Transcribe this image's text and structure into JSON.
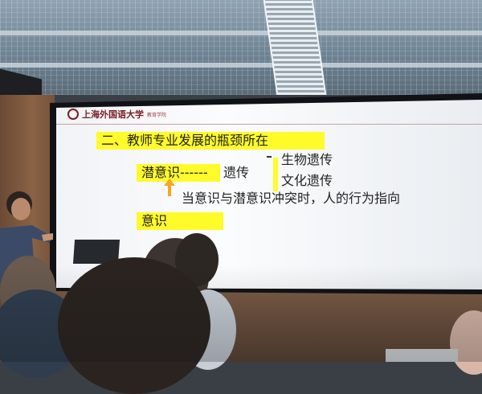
{
  "slide": {
    "logo_text": "上海外国语大学",
    "logo_subtext": "教育学院",
    "heading": "二、教师专业发展的瓶颈所在",
    "subconscious_label": "潜意识------",
    "inheritance_label": "遗传",
    "branch_items": [
      "生物遗传",
      "文化遗传"
    ],
    "conflict_note": "当意识与潜意识冲突时，人的行为指向",
    "conscious_label": "意识",
    "highlight_color": "#fffb2a",
    "arrow_color": "#f5a623"
  },
  "scene": {
    "icons": [
      "projector-screen",
      "ceiling-vent",
      "speaker",
      "laptop"
    ]
  }
}
